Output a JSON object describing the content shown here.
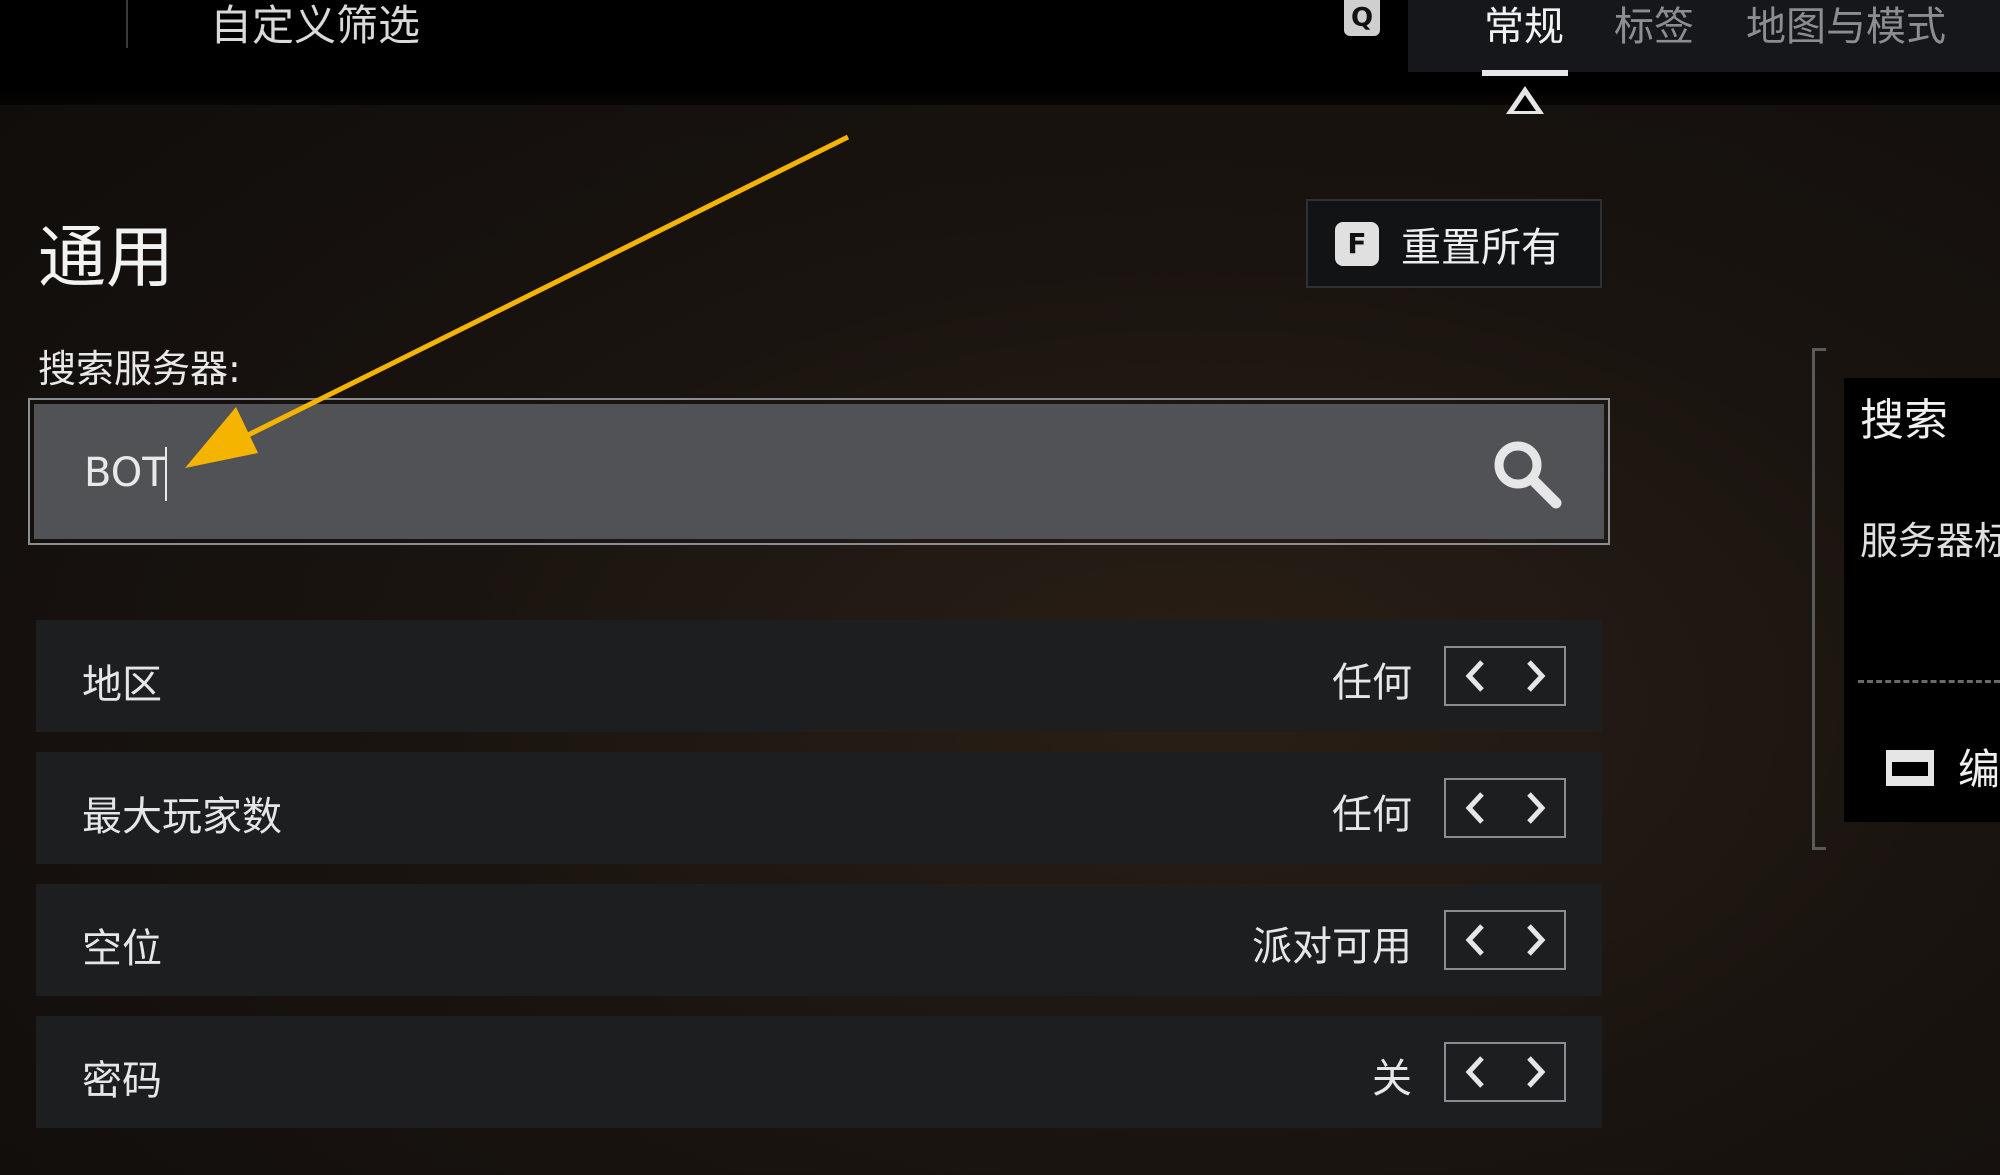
{
  "header": {
    "page_title": "自定义筛选",
    "key_hint": "Q",
    "tabs": [
      {
        "label": "常规",
        "active": true
      },
      {
        "label": "标签",
        "active": false
      },
      {
        "label": "地图与模式",
        "active": false
      }
    ]
  },
  "general": {
    "section_title": "通用",
    "reset": {
      "key": "F",
      "label": "重置所有"
    },
    "search": {
      "label": "搜索服务器:",
      "value": "BOT"
    },
    "filters": [
      {
        "label": "地区",
        "value": "任何"
      },
      {
        "label": "最大玩家数",
        "value": "任何"
      },
      {
        "label": "空位",
        "value": "派对可用"
      },
      {
        "label": "密码",
        "value": "关"
      }
    ]
  },
  "side_panel": {
    "title": "搜索",
    "subtitle": "服务器标",
    "edit_label": "编"
  },
  "colors": {
    "annotation_arrow": "#f5b400",
    "search_field_bg": "#505255",
    "row_bg": "#1d1e20"
  },
  "icons": [
    "search-icon",
    "chevron-left-icon",
    "chevron-right-icon",
    "edit-icon",
    "annotation-arrow"
  ]
}
